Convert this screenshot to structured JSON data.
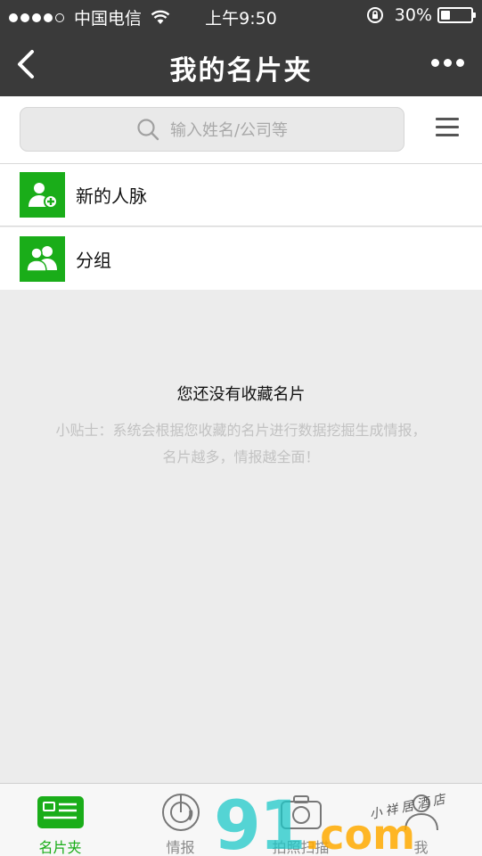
{
  "status_bar": {
    "carrier": "中国电信",
    "time": "上午9:50",
    "battery": "30%",
    "battery_level": 0.3
  },
  "nav": {
    "title": "我的名片夹"
  },
  "search": {
    "placeholder": "输入姓名/公司等"
  },
  "list": {
    "items": [
      {
        "label": "新的人脉",
        "icon": "add-contact-icon"
      },
      {
        "label": "分组",
        "icon": "group-icon"
      }
    ]
  },
  "empty_state": {
    "title": "您还没有收藏名片",
    "tip_line1": "小贴士：系统会根据您收藏的名片进行数据挖掘生成情报，",
    "tip_line2": "名片越多，情报越全面！"
  },
  "tabbar": {
    "tabs": [
      {
        "label": "名片夹",
        "icon": "card-holder-icon",
        "active": true
      },
      {
        "label": "情报",
        "icon": "radar-icon",
        "active": false
      },
      {
        "label": "拍照扫描",
        "icon": "camera-icon",
        "active": false
      },
      {
        "label": "我",
        "icon": "person-icon",
        "active": false
      }
    ]
  },
  "watermark": {
    "brand": "91",
    "suffix": ".com",
    "handwriting": "小祥居酒店"
  },
  "colors": {
    "accent": "#1aad19",
    "header": "#3a3a3a",
    "background": "#ececec"
  }
}
